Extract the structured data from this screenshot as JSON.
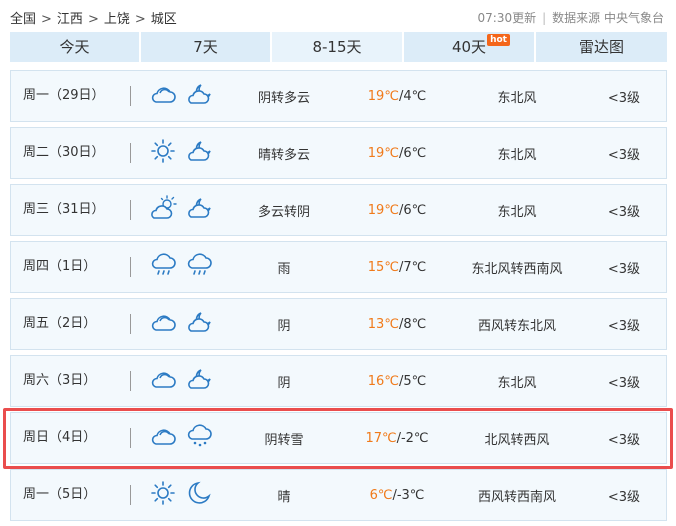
{
  "breadcrumb": {
    "items": [
      "全国",
      "江西",
      "上饶",
      "城区"
    ],
    "separator": ">"
  },
  "source": {
    "update_time": "07:30更新",
    "data_source": "数据来源 中央气象台"
  },
  "tabs": [
    {
      "label": "今天",
      "active": false
    },
    {
      "label": "7天",
      "active": false
    },
    {
      "label": "8-15天",
      "active": true
    },
    {
      "label": "40天",
      "badge": "hot",
      "active": false
    },
    {
      "label": "雷达图",
      "active": false
    }
  ],
  "colors": {
    "high_temp": "#f07a1a",
    "icon": "#2c7bc4",
    "highlight_border": "#ea4d4d",
    "badge": "#f4661b",
    "tab_bg": "#dcecf8"
  },
  "forecast": [
    {
      "day": "周一（29日）",
      "icons": [
        "cloud-icon",
        "night-partly-cloudy-icon"
      ],
      "desc": "阴转多云",
      "high": "19℃",
      "low": "/4℃",
      "wind": "东北风",
      "level": "<3级"
    },
    {
      "day": "周二（30日）",
      "icons": [
        "sun-icon",
        "night-partly-cloudy-icon"
      ],
      "desc": "晴转多云",
      "high": "19℃",
      "low": "/6℃",
      "wind": "东北风",
      "level": "<3级"
    },
    {
      "day": "周三（31日）",
      "icons": [
        "sun-cloud-icon",
        "night-partly-cloudy-icon"
      ],
      "desc": "多云转阴",
      "high": "19℃",
      "low": "/6℃",
      "wind": "东北风",
      "level": "<3级"
    },
    {
      "day": "周四（1日）",
      "icons": [
        "rain-icon",
        "rain-icon"
      ],
      "desc": "雨",
      "high": "15℃",
      "low": "/7℃",
      "wind": "东北风转西南风",
      "level": "<3级"
    },
    {
      "day": "周五（2日）",
      "icons": [
        "cloud-icon",
        "night-partly-cloudy-icon"
      ],
      "desc": "阴",
      "high": "13℃",
      "low": "/8℃",
      "wind": "西风转东北风",
      "level": "<3级"
    },
    {
      "day": "周六（3日）",
      "icons": [
        "cloud-icon",
        "night-partly-cloudy-icon"
      ],
      "desc": "阴",
      "high": "16℃",
      "low": "/5℃",
      "wind": "东北风",
      "level": "<3级"
    },
    {
      "day": "周日（4日）",
      "icons": [
        "cloud-icon",
        "snow-icon"
      ],
      "desc": "阴转雪",
      "high": "17℃",
      "low": "/-2℃",
      "wind": "北风转西风",
      "level": "<3级",
      "highlighted": true
    },
    {
      "day": "周一（5日）",
      "icons": [
        "sun-icon",
        "moon-icon"
      ],
      "desc": "晴",
      "high": "6℃",
      "low": "/-3℃",
      "wind": "西风转西南风",
      "level": "<3级"
    }
  ]
}
